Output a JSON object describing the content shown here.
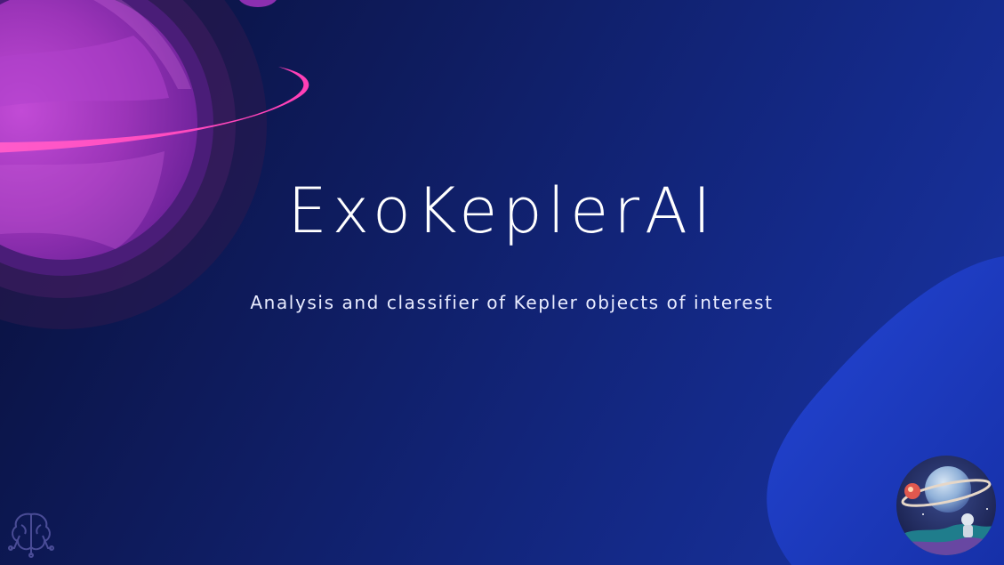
{
  "slide": {
    "title": "ExoKeplerAI",
    "subtitle": "Analysis and classifier of Kepler objects of interest"
  },
  "colors": {
    "background_dark": "#090f38",
    "background_light": "#1a35a6",
    "planet_purple": "#9b34b8",
    "ring_pink": "#ff4fc1",
    "title_text": "#ffffff"
  },
  "icons": {
    "corner_logo": "brain-circuit-icon",
    "avatar": "astronaut-planet-icon"
  }
}
